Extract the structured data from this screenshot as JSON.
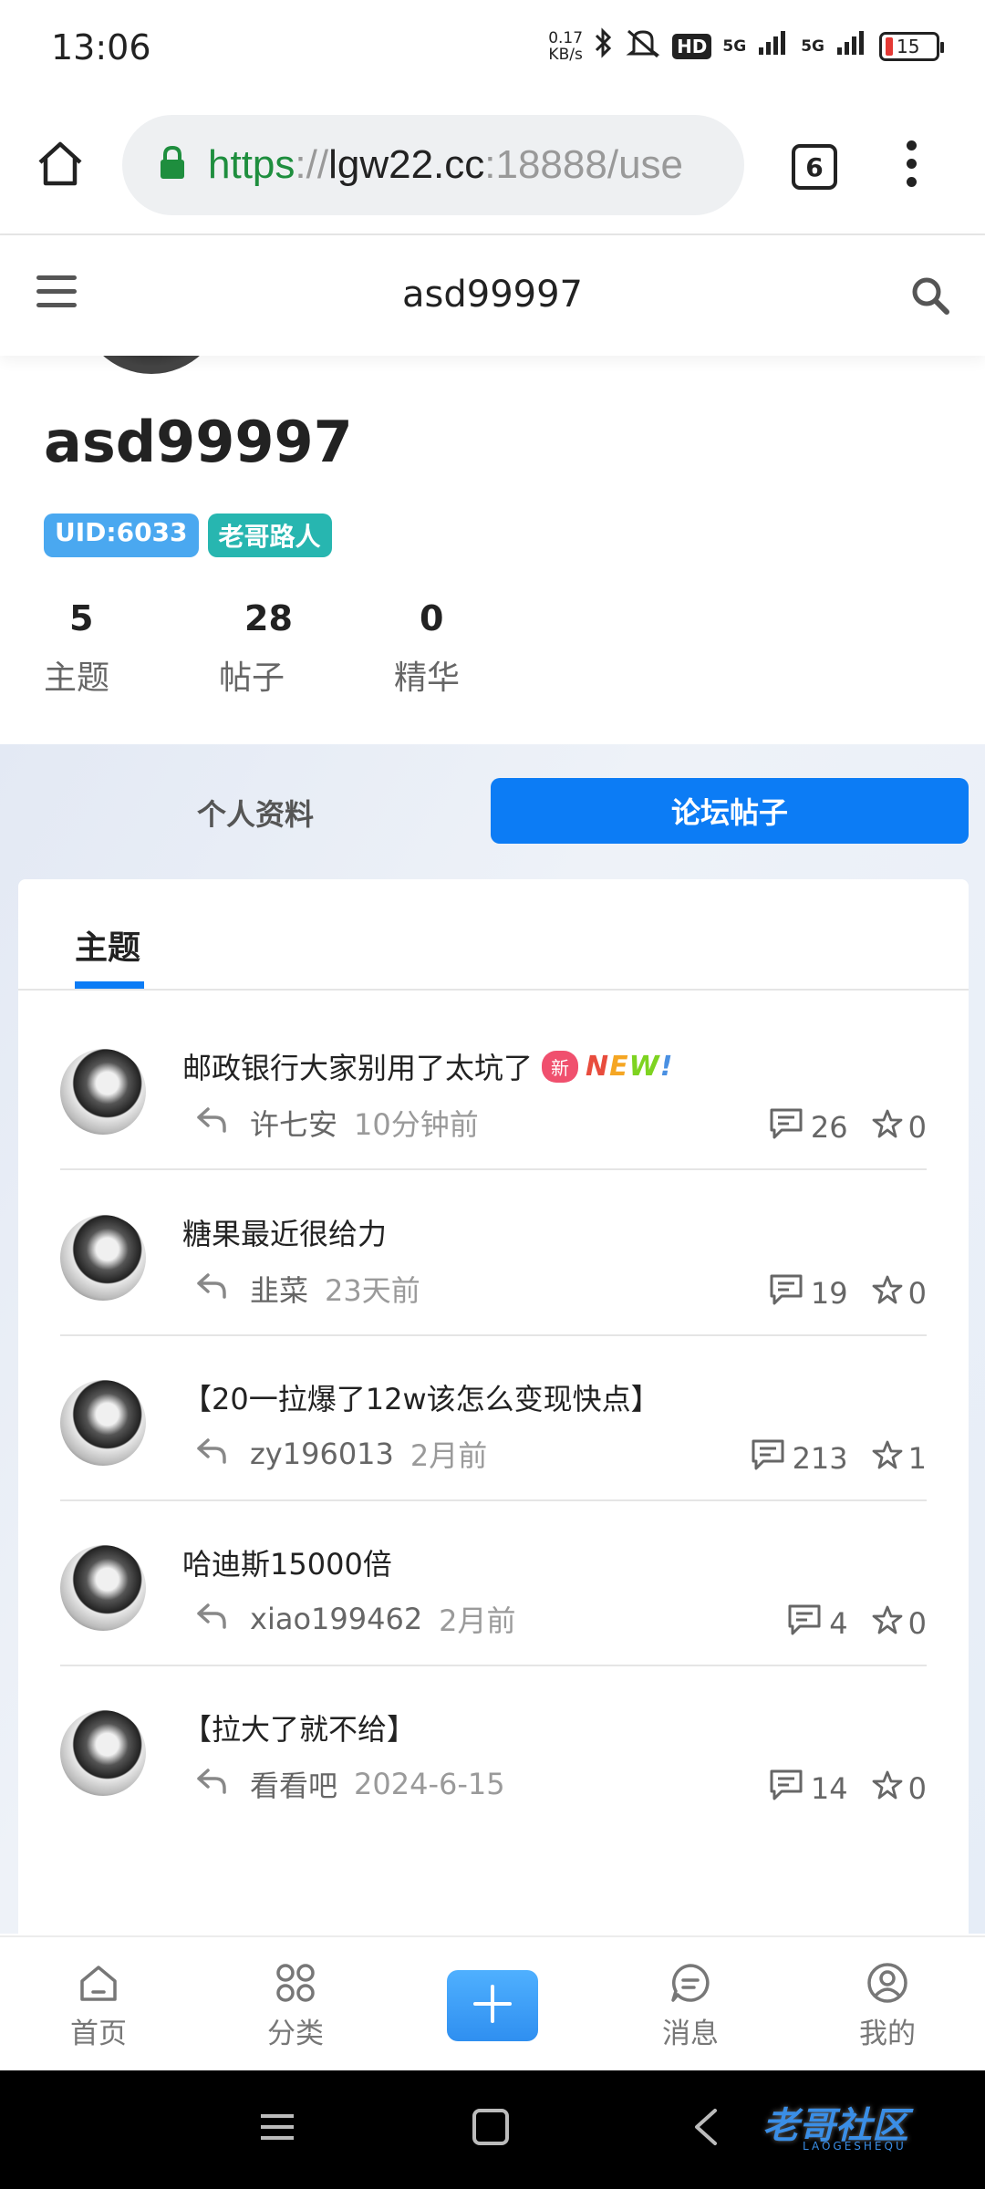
{
  "status_bar": {
    "time": "13:06",
    "net_speed_value": "0.17",
    "net_speed_unit": "KB/s",
    "hd_label": "HD",
    "sim1": "5G",
    "sim2": "5G",
    "battery": "15"
  },
  "browser": {
    "url_scheme": "https",
    "url_sep": "://",
    "url_host": "lgw22.cc",
    "url_rest": ":18888/use",
    "tab_count": "6"
  },
  "header": {
    "title": "asd99997"
  },
  "profile": {
    "username": "asd99997",
    "uid_badge": "UID:6033",
    "role_badge": "老哥路人",
    "stats": [
      {
        "value": "5",
        "label": "主题"
      },
      {
        "value": "28",
        "label": "帖子"
      },
      {
        "value": "0",
        "label": "精华"
      }
    ]
  },
  "tabs": {
    "left": "个人资料",
    "right": "论坛帖子",
    "sub": "主题"
  },
  "posts": [
    {
      "title": "邮政银行大家别用了太坑了",
      "new_tag": "新",
      "new_text": [
        "N",
        "E",
        "W",
        "!"
      ],
      "author": "许七安",
      "time": "10分钟前",
      "comments": "26",
      "stars": "0"
    },
    {
      "title": "糖果最近很给力",
      "author": "韭菜",
      "time": "23天前",
      "comments": "19",
      "stars": "0"
    },
    {
      "title": "【20一拉爆了12w该怎么变现快点】",
      "author": "zy196013",
      "time": "2月前",
      "comments": "213",
      "stars": "1"
    },
    {
      "title": "哈迪斯15000倍",
      "author": "xiao199462",
      "time": "2月前",
      "comments": "4",
      "stars": "0"
    },
    {
      "title": "【拉大了就不给】",
      "author": "看看吧",
      "time": "2024-6-15",
      "comments": "14",
      "stars": "0"
    }
  ],
  "bottom_nav": {
    "home": "首页",
    "category": "分类",
    "messages": "消息",
    "mine": "我的"
  },
  "watermark": {
    "text": "老哥社区",
    "sub": "LAOGESHEQU"
  },
  "colors": {
    "accent": "#0c7cf5",
    "uid_badge": "#4aa8f0",
    "role_badge": "#27b6b0",
    "new_tag": "#f0506e"
  }
}
